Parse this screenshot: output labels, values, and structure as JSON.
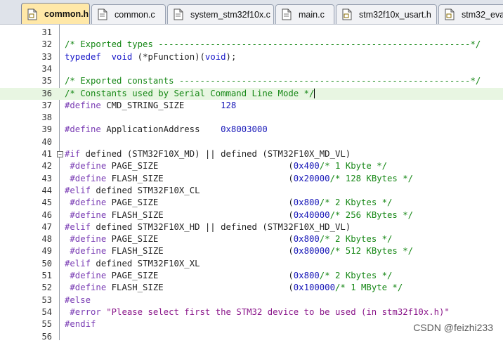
{
  "tabs": [
    {
      "label": "common.h",
      "icon": "header-file-icon",
      "active": true
    },
    {
      "label": "common.c",
      "icon": "source-file-icon",
      "active": false
    },
    {
      "label": "system_stm32f10x.c",
      "icon": "source-file-icon",
      "active": false
    },
    {
      "label": "main.c",
      "icon": "source-file-icon",
      "active": false
    },
    {
      "label": "stm32f10x_usart.h",
      "icon": "header-file-icon",
      "active": false
    },
    {
      "label": "stm32_eva",
      "icon": "header-file-icon",
      "active": false
    }
  ],
  "lines": [
    {
      "n": "31",
      "t": []
    },
    {
      "n": "32",
      "t": [
        [
          "c-com",
          "/* Exported types ------------------------------------------------------------*/"
        ]
      ]
    },
    {
      "n": "33",
      "t": [
        [
          "c-kw",
          "typedef"
        ],
        [
          "",
          "  "
        ],
        [
          "c-kw",
          "void"
        ],
        [
          "",
          " (*pFunction)("
        ],
        [
          "c-kw",
          "void"
        ],
        [
          "",
          ");"
        ]
      ]
    },
    {
      "n": "34",
      "t": []
    },
    {
      "n": "35",
      "t": [
        [
          "c-com",
          "/* Exported constants --------------------------------------------------------*/"
        ]
      ]
    },
    {
      "n": "36",
      "t": [
        [
          "c-com",
          "/* Constants used by Serial Command Line Mode */"
        ]
      ]
    },
    {
      "n": "37",
      "t": [
        [
          "c-pp",
          "#define"
        ],
        [
          "",
          " CMD_STRING_SIZE       "
        ],
        [
          "c-num",
          "128"
        ]
      ]
    },
    {
      "n": "38",
      "t": []
    },
    {
      "n": "39",
      "t": [
        [
          "c-pp",
          "#define"
        ],
        [
          "",
          " ApplicationAddress    "
        ],
        [
          "c-num",
          "0x8003000"
        ]
      ]
    },
    {
      "n": "40",
      "t": []
    },
    {
      "n": "41",
      "t": [
        [
          "c-pp",
          "#if"
        ],
        [
          "",
          " defined (STM32F10X_MD) || defined (STM32F10X_MD_VL)"
        ]
      ]
    },
    {
      "n": "42",
      "t": [
        [
          "",
          ""
        ],
        [
          "c-pp",
          " #define"
        ],
        [
          "",
          " PAGE_SIZE                         ("
        ],
        [
          "c-num",
          "0x400"
        ],
        [
          ")    "
        ],
        [
          "c-com",
          "/* 1 Kbyte */"
        ]
      ]
    },
    {
      "n": "43",
      "t": [
        [
          "",
          ""
        ],
        [
          "c-pp",
          " #define"
        ],
        [
          "",
          " FLASH_SIZE                        ("
        ],
        [
          "c-num",
          "0x20000"
        ],
        [
          ")  "
        ],
        [
          "c-com",
          "/* 128 KBytes */"
        ]
      ]
    },
    {
      "n": "44",
      "t": [
        [
          "c-pp",
          "#elif"
        ],
        [
          "",
          " defined STM32F10X_CL"
        ]
      ]
    },
    {
      "n": "45",
      "t": [
        [
          "",
          ""
        ],
        [
          "c-pp",
          " #define"
        ],
        [
          "",
          " PAGE_SIZE                         ("
        ],
        [
          "c-num",
          "0x800"
        ],
        [
          ")    "
        ],
        [
          "c-com",
          "/* 2 Kbytes */"
        ]
      ]
    },
    {
      "n": "46",
      "t": [
        [
          "",
          ""
        ],
        [
          "c-pp",
          " #define"
        ],
        [
          "",
          " FLASH_SIZE                        ("
        ],
        [
          "c-num",
          "0x40000"
        ],
        [
          ")  "
        ],
        [
          "c-com",
          "/* 256 KBytes */"
        ]
      ]
    },
    {
      "n": "47",
      "t": [
        [
          "c-pp",
          "#elif"
        ],
        [
          "",
          " defined STM32F10X_HD || defined (STM32F10X_HD_VL)"
        ]
      ]
    },
    {
      "n": "48",
      "t": [
        [
          "",
          ""
        ],
        [
          "c-pp",
          " #define"
        ],
        [
          "",
          " PAGE_SIZE                         ("
        ],
        [
          "c-num",
          "0x800"
        ],
        [
          ")    "
        ],
        [
          "c-com",
          "/* 2 Kbytes */"
        ]
      ]
    },
    {
      "n": "49",
      "t": [
        [
          "",
          ""
        ],
        [
          "c-pp",
          " #define"
        ],
        [
          "",
          " FLASH_SIZE                        ("
        ],
        [
          "c-num",
          "0x80000"
        ],
        [
          ")  "
        ],
        [
          "c-com",
          "/* 512 KBytes */"
        ]
      ]
    },
    {
      "n": "50",
      "t": [
        [
          "c-pp",
          "#elif"
        ],
        [
          "",
          " defined STM32F10X_XL"
        ]
      ]
    },
    {
      "n": "51",
      "t": [
        [
          "",
          ""
        ],
        [
          "c-pp",
          " #define"
        ],
        [
          "",
          " PAGE_SIZE                         ("
        ],
        [
          "c-num",
          "0x800"
        ],
        [
          ")    "
        ],
        [
          "c-com",
          "/* 2 Kbytes */"
        ]
      ]
    },
    {
      "n": "52",
      "t": [
        [
          "",
          ""
        ],
        [
          "c-pp",
          " #define"
        ],
        [
          "",
          " FLASH_SIZE                        ("
        ],
        [
          "c-num",
          "0x100000"
        ],
        [
          ") "
        ],
        [
          "c-com",
          "/* 1 MByte */"
        ]
      ]
    },
    {
      "n": "53",
      "t": [
        [
          "c-pp",
          "#else"
        ]
      ]
    },
    {
      "n": "54",
      "t": [
        [
          "c-pp",
          " #error"
        ],
        [
          "c-str",
          " \"Please select first the STM32 device to be used (in stm32f10x.h)\""
        ]
      ]
    },
    {
      "n": "55",
      "t": [
        [
          "c-pp",
          "#endif"
        ]
      ]
    },
    {
      "n": "56",
      "t": []
    }
  ],
  "current_line": "36",
  "fold_line": "41",
  "watermark": "CSDN @feizhi233",
  "colors": {
    "comment": "#158715",
    "keyword": "#1515c8",
    "preprocessor": "#7a3cb4",
    "number": "#1717b8",
    "string": "#8a168a",
    "active_tab": "#ffe8a8",
    "current_line": "#e8f6e2"
  }
}
